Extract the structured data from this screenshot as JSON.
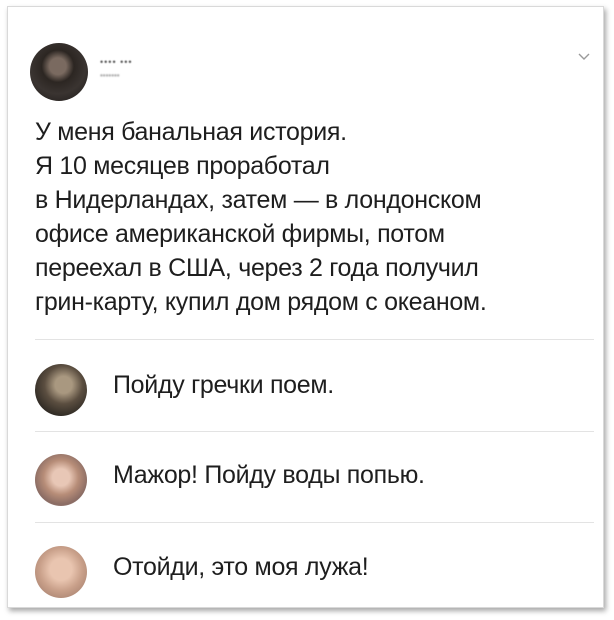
{
  "post": {
    "author_name": "•••• •••",
    "author_handle": "•••••••",
    "lines": [
      "У меня банальная история.",
      "Я 10 месяцев проработал",
      "в Нидерландах, затем — в лондонском",
      "офисе американской фирмы, потом",
      "переехал в США, через 2 года получил",
      "грин-карту, купил дом рядом с океаном."
    ],
    "menu_icon": "chevron-down-icon"
  },
  "replies": [
    {
      "text": "Пойду гречки поем."
    },
    {
      "text": "Мажор! Пойду воды попью."
    },
    {
      "text": "Отойди, это моя лужа!"
    }
  ],
  "colors": {
    "text": "#1e1e1e",
    "divider": "#e3e3e3",
    "chevron": "#9a9a9a"
  }
}
